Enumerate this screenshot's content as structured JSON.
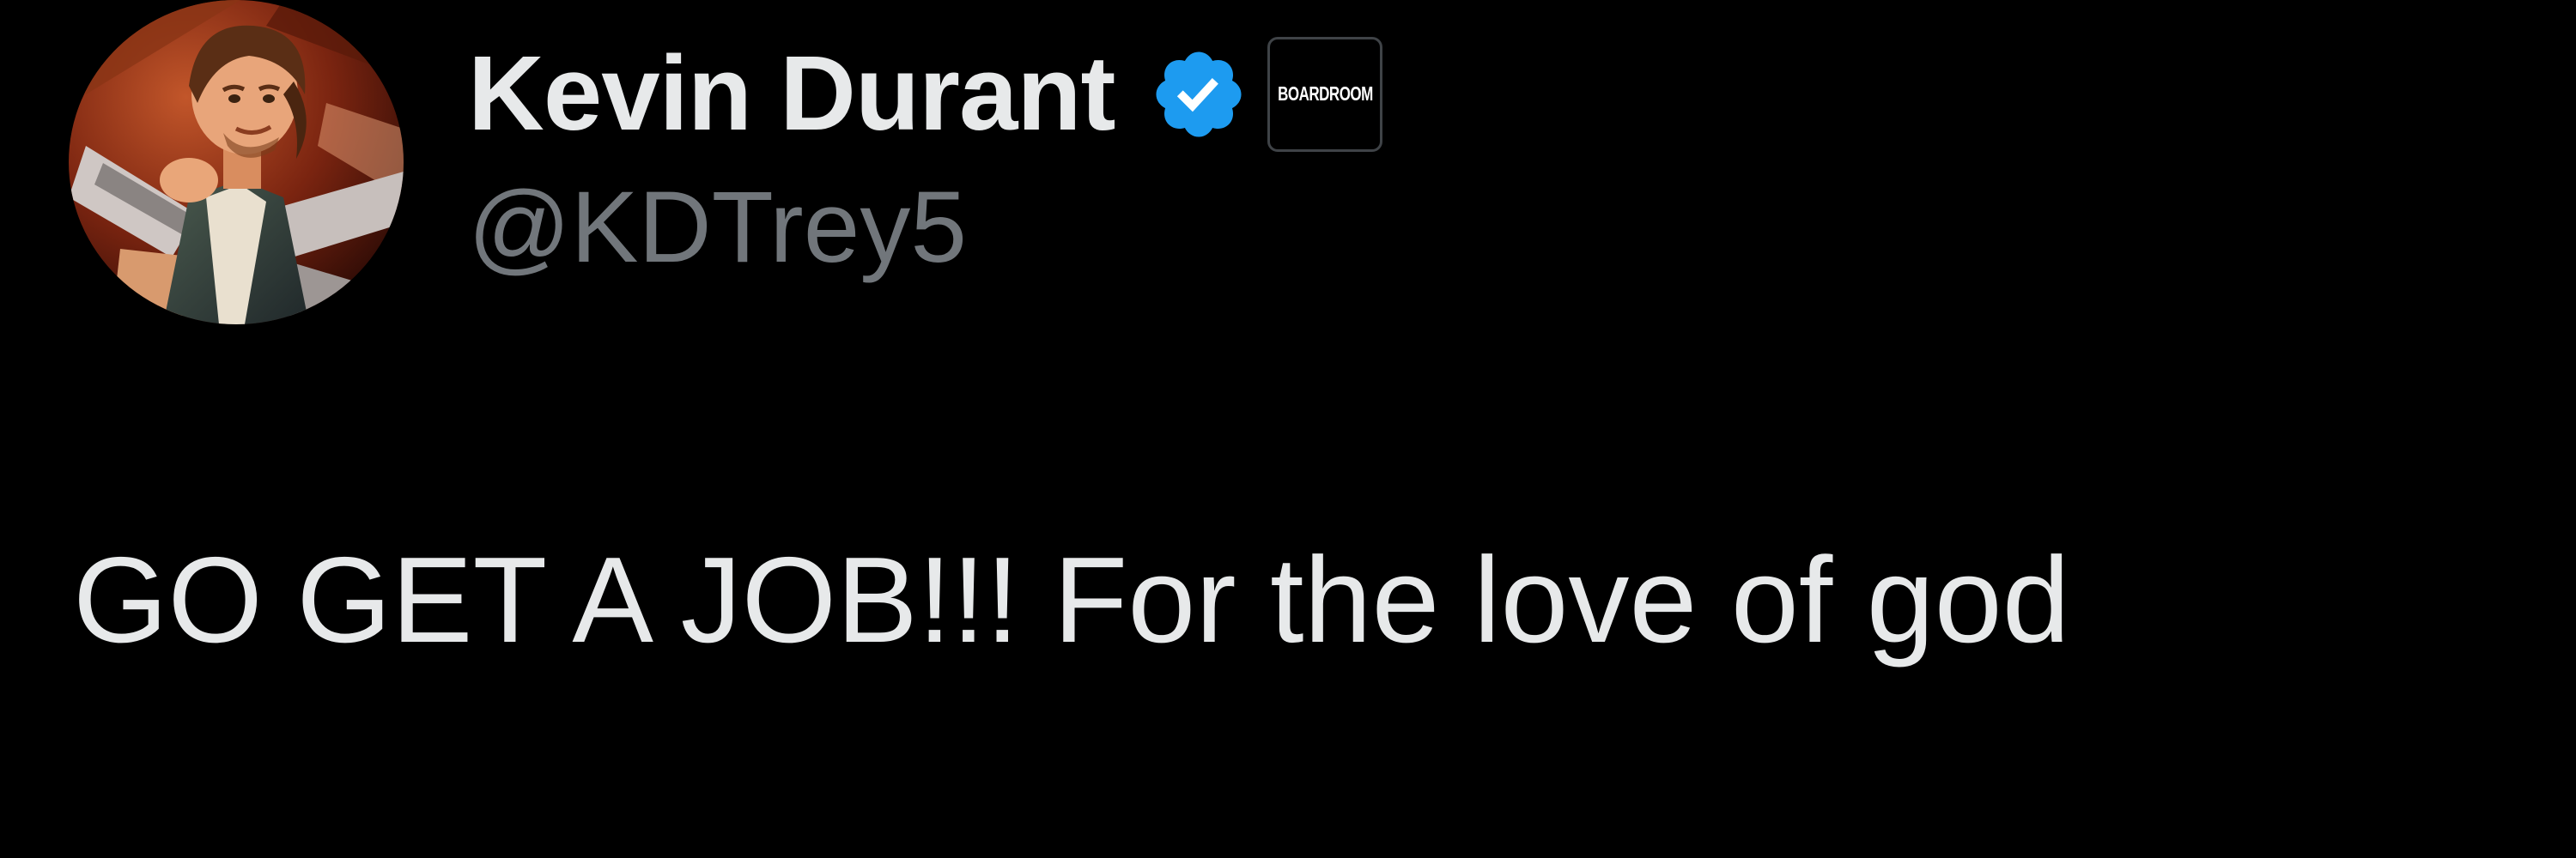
{
  "author": {
    "display_name": "Kevin Durant",
    "handle": "@KDTrey5",
    "avatar_icon": "profile-avatar",
    "verified_icon": "verified-badge-icon",
    "verified_color": "#1d9bf0",
    "affiliate_label": "BOARDROOM"
  },
  "tweet": {
    "text": "GO GET A JOB!!! For the love of god"
  },
  "colors": {
    "background": "#000000",
    "primary_text": "#e7e9ea",
    "secondary_text": "#71767b"
  }
}
